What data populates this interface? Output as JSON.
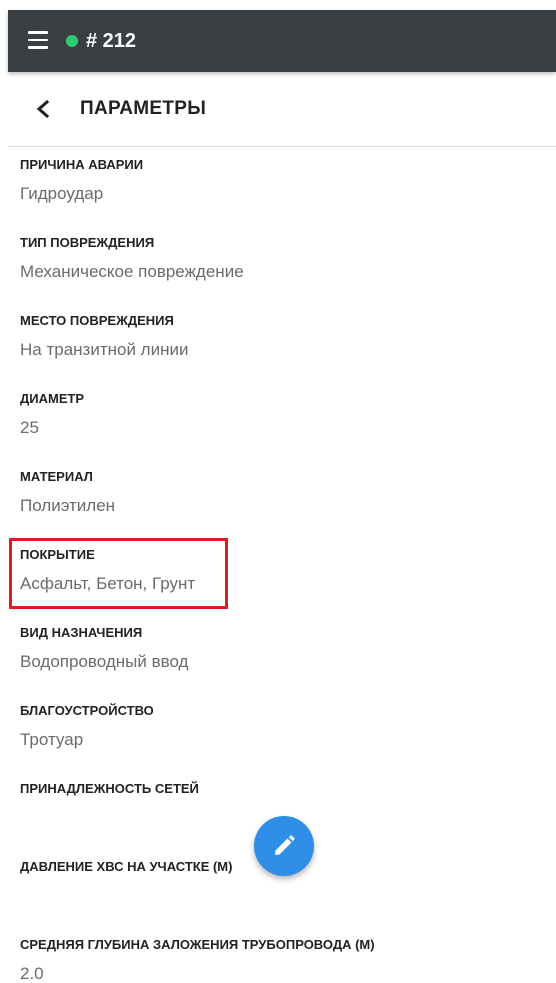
{
  "app_bar": {
    "order_id": "# 212",
    "status_color": "#2ecc71",
    "menu_icon": "hamburger-menu-icon"
  },
  "header": {
    "title": "ПАРАМЕТРЫ",
    "back_icon": "chevron-left-icon"
  },
  "fields": [
    {
      "label": "ПРИЧИНА АВАРИИ",
      "value": "Гидроудар"
    },
    {
      "label": "ТИП ПОВРЕЖДЕНИЯ",
      "value": "Механическое повреждение"
    },
    {
      "label": "МЕСТО ПОВРЕЖДЕНИЯ",
      "value": "На транзитной линии"
    },
    {
      "label": "ДИАМЕТР",
      "value": "25"
    },
    {
      "label": "МАТЕРИАЛ",
      "value": "Полиэтилен"
    },
    {
      "label": "ПОКРЫТИЕ",
      "value": "Асфальт, Бетон, Грунт"
    },
    {
      "label": "ВИД НАЗНАЧЕНИЯ",
      "value": "Водопроводный ввод"
    },
    {
      "label": "БЛАГОУСТРОЙСТВО",
      "value": "Тротуар"
    },
    {
      "label": "ПРИНАДЛЕЖНОСТЬ СЕТЕЙ",
      "value": ""
    },
    {
      "label": "ДАВЛЕНИЕ ХВС НА УЧАСТКЕ (М)",
      "value": ""
    },
    {
      "label": "СРЕДНЯЯ ГЛУБИНА ЗАЛОЖЕНИЯ ТРУБОПРОВОДА (М)",
      "value": "2.0"
    }
  ],
  "highlight": {
    "color": "#e01b24",
    "field": "ПОКРЫТИЕ"
  },
  "fab": {
    "icon": "pencil-edit-icon",
    "color": "#2e8ee8"
  }
}
